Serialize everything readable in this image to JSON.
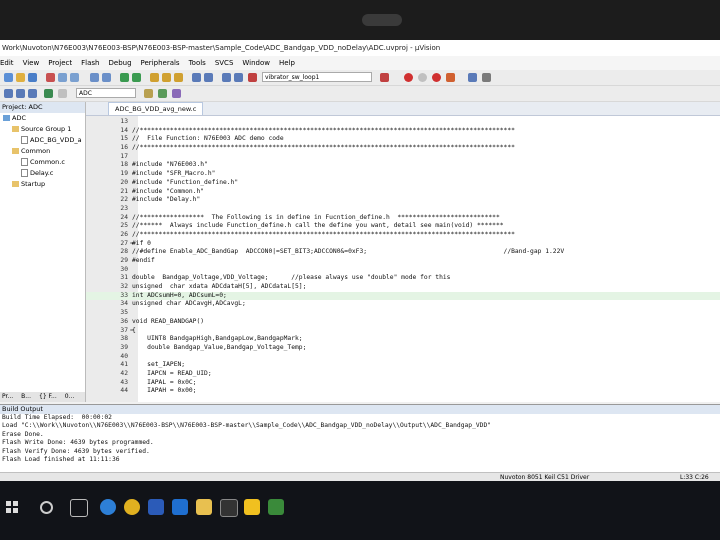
{
  "window": {
    "title": "Work\\Nuvoton\\N76E003\\N76E003-BSP\\N76E003-BSP-master\\Sample_Code\\ADC_Bandgap_VDD_noDelay\\ADC.uvproj - µVision"
  },
  "menu": [
    "Edit",
    "View",
    "Project",
    "Flash",
    "Debug",
    "Peripherals",
    "Tools",
    "SVCS",
    "Window",
    "Help"
  ],
  "toolbar": {
    "target": "ADC",
    "search_combo": "vibrator_sw_loop1"
  },
  "project": {
    "header": "Project: ADC",
    "tree": [
      {
        "label": "ADC",
        "depth": 0,
        "kind": "root"
      },
      {
        "label": "Source Group 1",
        "depth": 1,
        "kind": "folder"
      },
      {
        "label": "ADC_BG_VDD_a",
        "depth": 2,
        "kind": "file"
      },
      {
        "label": "Common",
        "depth": 1,
        "kind": "folder"
      },
      {
        "label": "Common.c",
        "depth": 2,
        "kind": "file"
      },
      {
        "label": "Delay.c",
        "depth": 2,
        "kind": "file"
      },
      {
        "label": "Startup",
        "depth": 1,
        "kind": "folder"
      }
    ],
    "tabs": [
      "Pr...",
      "B...",
      "{} F...",
      "0..."
    ]
  },
  "editor": {
    "tab": "ADC_BG_VDD_avg_new.c",
    "lines": [
      {
        "n": "13",
        "code": ""
      },
      {
        "n": "14",
        "code": "//***************************************************************************************************"
      },
      {
        "n": "15",
        "code": "//  File Function: N76E003 ADC demo code"
      },
      {
        "n": "16",
        "code": "//***************************************************************************************************"
      },
      {
        "n": "17",
        "code": ""
      },
      {
        "n": "18",
        "code": "#include \"N76E003.h\""
      },
      {
        "n": "19",
        "code": "#include \"SFR_Macro.h\""
      },
      {
        "n": "20",
        "code": "#include \"Function_define.h\""
      },
      {
        "n": "21",
        "code": "#include \"Common.h\""
      },
      {
        "n": "22",
        "code": "#include \"Delay.h\""
      },
      {
        "n": "23",
        "code": ""
      },
      {
        "n": "24",
        "code": "//*****************  The Following is in define in Fucntion_define.h  ***************************"
      },
      {
        "n": "25",
        "code": "//******  Always include Function_define.h call the define you want, detail see main(void) *******"
      },
      {
        "n": "26",
        "code": "//***************************************************************************************************"
      },
      {
        "n": "27",
        "code": "#if 0",
        "fold": "="
      },
      {
        "n": "28",
        "code": "//#define Enable_ADC_BandGap  ADCCON0|=SET_BIT3;ADCCON0&=0xF3;                                    //Band-gap 1.22V"
      },
      {
        "n": "29",
        "code": "#endif"
      },
      {
        "n": "30",
        "code": ""
      },
      {
        "n": "31",
        "code": "double  Bandgap_Voltage,VDD_Voltage;      //please always use \"double\" mode for this"
      },
      {
        "n": "32",
        "code": "unsigned  char xdata ADCdataH[5], ADCdataL[5];"
      },
      {
        "n": "33",
        "code": "int ADCsumH=0, ADCsumL=0;",
        "cur": true
      },
      {
        "n": "34",
        "code": "unsigned char ADCavgH,ADCavgL;"
      },
      {
        "n": "35",
        "code": ""
      },
      {
        "n": "36",
        "code": "void READ_BANDGAP()"
      },
      {
        "n": "37",
        "code": "{",
        "fold": "="
      },
      {
        "n": "38",
        "code": "    UINT8 BandgapHigh,BandgapLow,BandgapMark;"
      },
      {
        "n": "39",
        "code": "    double Bandgap_Value,Bandgap_Voltage_Temp;"
      },
      {
        "n": "40",
        "code": ""
      },
      {
        "n": "41",
        "code": "    set_IAPEN;"
      },
      {
        "n": "42",
        "code": "    IAPCN = READ_UID;"
      },
      {
        "n": "43",
        "code": "    IAPAL = 0x0C;"
      },
      {
        "n": "44",
        "code": "    IAPAH = 0x00;"
      }
    ]
  },
  "output": {
    "header": "Build Output",
    "lines": [
      "Build Time Elapsed:  00:00:02",
      "Load \"C:\\\\Work\\\\Nuvoton\\\\N76E003\\\\N76E003-BSP\\\\N76E003-BSP-master\\\\Sample_Code\\\\ADC_Bandgap_VDD_noDelay\\\\Output\\\\ADC_Bandgap_VDD\"",
      "Erase Done.",
      "Flash Write Done: 4639 bytes programmed.",
      "Flash Verify Done: 4639 bytes verified.",
      "Flash Load finished at 11:11:36"
    ]
  },
  "status": {
    "driver": "Nuvoton 8051 Keil C51 Driver",
    "position": "L:33 C:26"
  },
  "colors": {
    "accent": "#dde6f2",
    "current_line": "#e4f4e4",
    "taskbar": "#111318"
  }
}
